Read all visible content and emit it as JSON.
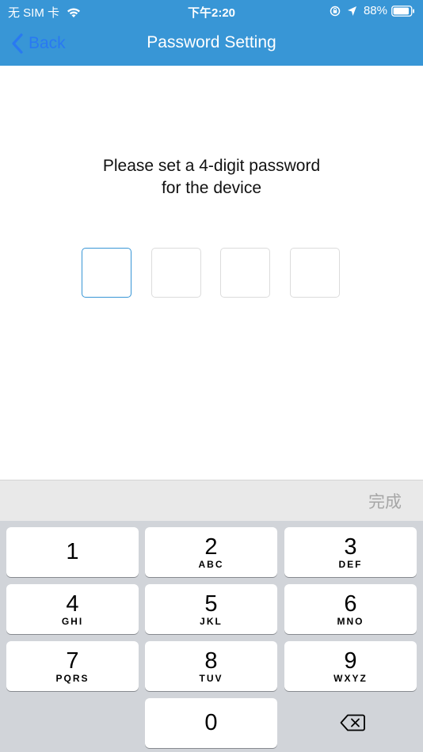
{
  "status_bar": {
    "carrier": "无 SIM 卡",
    "time": "下午2:20",
    "battery": "88%"
  },
  "nav": {
    "back_label": "Back",
    "title": "Password Setting"
  },
  "prompt": {
    "line1": "Please set a 4-digit password",
    "line2": "for the device"
  },
  "code": {
    "digits": 4,
    "active_index": 0
  },
  "keyboard": {
    "done_label": "完成",
    "keys": [
      {
        "num": "1",
        "letters": ""
      },
      {
        "num": "2",
        "letters": "ABC"
      },
      {
        "num": "3",
        "letters": "DEF"
      },
      {
        "num": "4",
        "letters": "GHI"
      },
      {
        "num": "5",
        "letters": "JKL"
      },
      {
        "num": "6",
        "letters": "MNO"
      },
      {
        "num": "7",
        "letters": "PQRS"
      },
      {
        "num": "8",
        "letters": "TUV"
      },
      {
        "num": "9",
        "letters": "WXYZ"
      },
      {
        "num": "0",
        "letters": ""
      }
    ]
  },
  "colors": {
    "header": "#3896d6",
    "back": "#2979f2",
    "keyboard_bg": "#d1d4d9",
    "accessory_bg": "#e9e9e9",
    "active_box": "#3896d6"
  },
  "icons": {
    "wifi": "wifi-icon",
    "orientation_lock": "orientation-lock-icon",
    "location": "location-arrow-icon",
    "battery": "battery-icon",
    "back": "chevron-left-icon",
    "delete": "backspace-icon"
  }
}
